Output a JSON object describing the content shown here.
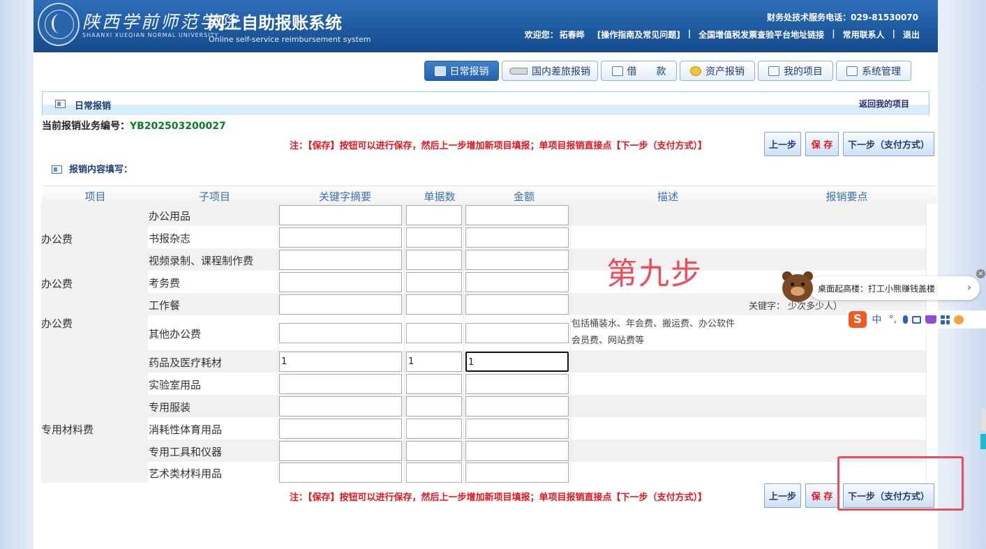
{
  "header": {
    "school_cn": "陕西学前师范学院",
    "school_en": "SHAANXI XUEQIAN NORMAL UNIVERSITY",
    "system_cn": "网上自助报账系统",
    "system_en": "Online self-service reimbursement system",
    "hotline": "财务处技术服务电话：029-81530070",
    "welcome_label": "欢迎您：",
    "user_name": "拓春晔",
    "guide_link": "[操作指南及常见问题]",
    "invoice_link": "全国增值税发票查验平台地址链接",
    "contacts_link": "常用联系人",
    "logout_link": "退出",
    "separator": "|"
  },
  "tabs": [
    {
      "label": "日常报销",
      "icon": "form-icon",
      "active": true
    },
    {
      "label": "国内差旅报销",
      "icon": "train-icon",
      "active": false
    },
    {
      "label": "借　　款",
      "icon": "loan-icon",
      "active": false
    },
    {
      "label": "资产报销",
      "icon": "coin-icon",
      "active": false
    },
    {
      "label": "我的项目",
      "icon": "list-icon",
      "active": false
    },
    {
      "label": "系统管理",
      "icon": "settings-icon",
      "active": false
    }
  ],
  "section": {
    "title": "日常报销",
    "back_link": "返回我的项目"
  },
  "business": {
    "label": "当前报销业务编号：",
    "code": "YB202503200027"
  },
  "note": "注：【保存】按钮可以进行保存，然后上一步增加新项目填报；单项目报销直接点【下一步（支付方式）】",
  "buttons": {
    "prev": "上一步",
    "save": "保 存",
    "next": "下一步（支付方式）"
  },
  "content_title": "报销内容填写：",
  "table": {
    "headers": [
      "项目",
      "子项目",
      "关键字摘要",
      "单据数",
      "金额",
      "描述",
      "报销要点"
    ],
    "categories": [
      {
        "name": "办公费"
      },
      {
        "name": "办公费"
      },
      {
        "name": "办公费"
      },
      {
        "name": "专用材料费"
      }
    ],
    "rows": [
      {
        "sub": "办公用品",
        "keyword": "",
        "count": "",
        "amount": "",
        "desc": ""
      },
      {
        "sub": "书报杂志",
        "keyword": "",
        "count": "",
        "amount": "",
        "desc": ""
      },
      {
        "sub": "视频录制、课程制作费",
        "keyword": "",
        "count": "",
        "amount": "",
        "desc": ""
      },
      {
        "sub": "考务费",
        "keyword": "",
        "count": "",
        "amount": "",
        "desc": ""
      },
      {
        "sub": "工作餐",
        "keyword": "",
        "count": "",
        "amount": "",
        "desc": ""
      },
      {
        "sub": "其他办公费",
        "keyword": "",
        "count": "",
        "amount": "",
        "desc_line1": "包括桶装水、年会费、搬运费、办公软件",
        "desc_line2": "会员费、网站费等"
      },
      {
        "sub": "药品及医疗耗材",
        "keyword": "1",
        "count": "1",
        "amount": "1",
        "desc": ""
      },
      {
        "sub": "实验室用品",
        "keyword": "",
        "count": "",
        "amount": "",
        "desc": ""
      },
      {
        "sub": "专用服装",
        "keyword": "",
        "count": "",
        "amount": "",
        "desc": ""
      },
      {
        "sub": "消耗性体育用品",
        "keyword": "",
        "count": "",
        "amount": "",
        "desc": ""
      },
      {
        "sub": "专用工具和仪器",
        "keyword": "",
        "count": "",
        "amount": "",
        "desc": ""
      },
      {
        "sub": "艺术类材料用品",
        "keyword": "",
        "count": "",
        "amount": "",
        "desc": ""
      }
    ],
    "partial_text": "关键字：       少次多少人）"
  },
  "annotation": {
    "step_label": "第九步"
  },
  "ad": {
    "text": "桌面起高楼：打工小熊赚钱盖楼",
    "arrow": "›",
    "close": "×"
  },
  "ime": {
    "logo": "S",
    "lang": "中",
    "punct": "°,"
  }
}
